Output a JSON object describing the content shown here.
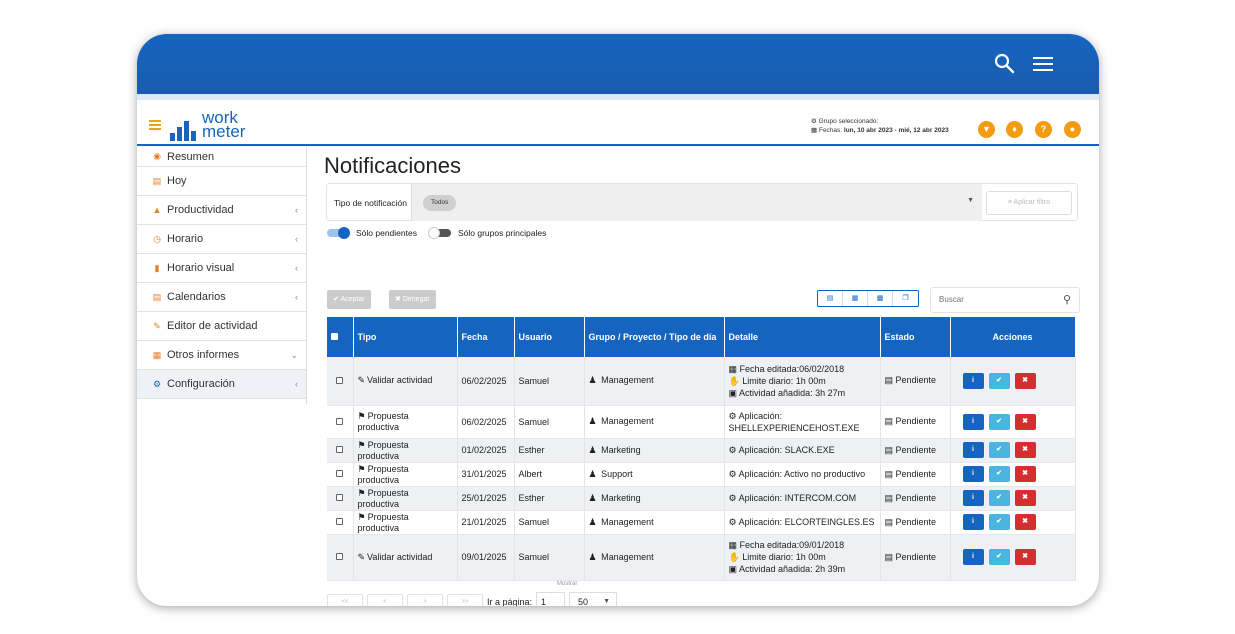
{
  "app": {
    "logo_text_1": "work",
    "logo_text_2": "meter",
    "brand_color": "#1565c0",
    "accent_color": "#f39c12"
  },
  "header": {
    "group_label": "Grupo seleccionado:",
    "dates_label": "Fechas:",
    "dates_value": "lun, 10 abr 2023 - mié, 12 abr 2023",
    "icons": [
      "filter-icon",
      "bell-icon",
      "help-icon",
      "user-icon"
    ]
  },
  "sidebar": {
    "items": [
      {
        "label": "Resumen",
        "icon": "dashboard-icon",
        "chevron": ""
      },
      {
        "label": "Hoy",
        "icon": "calendar-icon",
        "chevron": ""
      },
      {
        "label": "Productividad",
        "icon": "area-chart-icon",
        "chevron": "‹"
      },
      {
        "label": "Horario",
        "icon": "clock-icon",
        "chevron": "‹"
      },
      {
        "label": "Horario visual",
        "icon": "bar-chart-icon",
        "chevron": "‹"
      },
      {
        "label": "Calendarios",
        "icon": "calendar-icon",
        "chevron": "‹"
      },
      {
        "label": "Editor de actividad",
        "icon": "edit-icon",
        "chevron": ""
      },
      {
        "label": "Otros informes",
        "icon": "table-icon",
        "chevron": "⌄"
      },
      {
        "label": "Configuración",
        "icon": "gear-icon",
        "chevron": "‹"
      }
    ]
  },
  "main": {
    "title": "Notificaciones",
    "filter": {
      "label": "Tipo de notificación",
      "chip": "Todos",
      "apply_label": "Aplicar filtro"
    },
    "toggles": {
      "pending_label": "Sólo pendientes",
      "pending_on": true,
      "groups_label": "Sólo grupos principales",
      "groups_on": false
    },
    "actions": {
      "accept_label": "Aceptar",
      "deny_label": "Denegar"
    },
    "search_placeholder": "Buscar",
    "table": {
      "headers": [
        "Tipo",
        "Fecha",
        "Usuario",
        "Grupo / Proyecto / Tipo de día",
        "Detalle",
        "Estado",
        "Acciones"
      ],
      "rows": [
        {
          "tipo": "Validar actividad",
          "fecha": "06/02/2025",
          "usuario": "Samuel",
          "grupo": "Management",
          "detalle": [
            "Fecha editada:06/02/2018",
            "Limite diario: 1h 00m",
            "Actividad añadida: 3h 27m"
          ],
          "estado": "Pendiente"
        },
        {
          "tipo": "Propuesta productiva",
          "fecha": "06/02/2025",
          "usuario": "Samuel",
          "grupo": "Management",
          "detalle": [
            "Aplicación:",
            "SHELLEXPERIENCEHOST.EXE"
          ],
          "estado": "Pendiente"
        },
        {
          "tipo": "Propuesta productiva",
          "fecha": "01/02/2025",
          "usuario": "Esther",
          "grupo": "Marketing",
          "detalle": [
            "Aplicación: SLACK.EXE"
          ],
          "estado": "Pendiente"
        },
        {
          "tipo": "Propuesta productiva",
          "fecha": "31/01/2025",
          "usuario": "Albert",
          "grupo": "Support",
          "detalle": [
            "Aplicación: Activo no productivo"
          ],
          "estado": "Pendiente"
        },
        {
          "tipo": "Propuesta productiva",
          "fecha": "25/01/2025",
          "usuario": "Esther",
          "grupo": "Marketing",
          "detalle": [
            "Aplicación: INTERCOM.COM"
          ],
          "estado": "Pendiente"
        },
        {
          "tipo": "Propuesta productiva",
          "fecha": "21/01/2025",
          "usuario": "Samuel",
          "grupo": "Management",
          "detalle": [
            "Aplicación: ELCORTEINGLES.ES"
          ],
          "estado": "Pendiente"
        },
        {
          "tipo": "Validar actividad",
          "fecha": "09/01/2025",
          "usuario": "Samuel",
          "grupo": "Management",
          "detalle": [
            "Fecha editada:09/01/2018",
            "Limite diario: 1h 00m",
            "Actividad añadida: 2h 39m"
          ],
          "estado": "Pendiente"
        }
      ]
    },
    "pager": {
      "first": "<<",
      "prev": "<",
      "next": ">",
      "last": ">>",
      "goto_label": "Ir a página:",
      "page": "1",
      "show_label": "Mostrar",
      "page_size": "50"
    }
  }
}
